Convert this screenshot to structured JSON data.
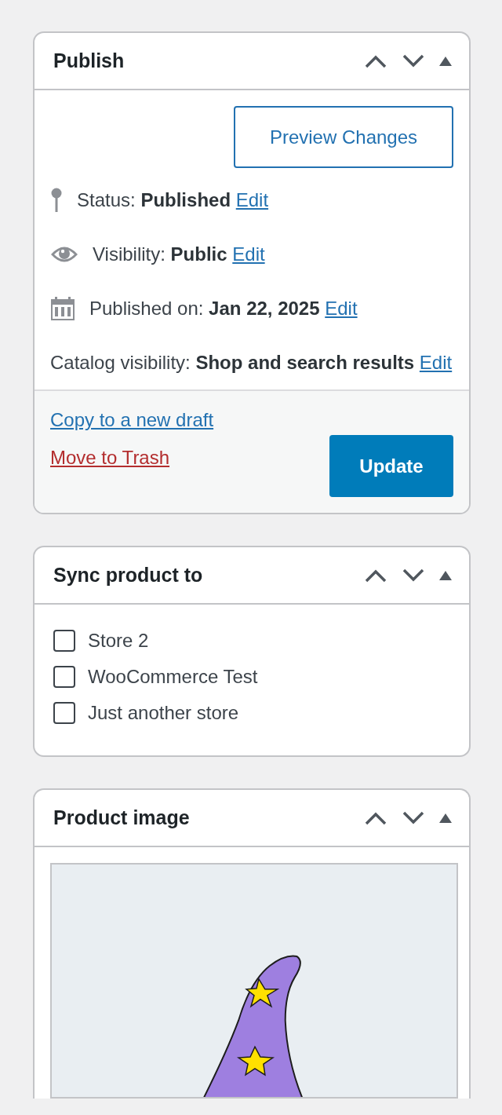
{
  "publish": {
    "title": "Publish",
    "preview_button": "Preview Changes",
    "rows": [
      {
        "kind": "pin",
        "label": "Status:",
        "value": "Published",
        "link": "Edit"
      },
      {
        "kind": "eye",
        "label": "Visibility:",
        "value": "Public",
        "link": "Edit"
      },
      {
        "kind": "calendar",
        "label": "Published on:",
        "value": "Jan 22, 2025",
        "link": "Edit"
      },
      {
        "kind": "plain",
        "label": "Catalog visibility:",
        "value": "Shop and search results",
        "link": "Edit"
      }
    ],
    "copy_link": "Copy to a new draft",
    "trash_link": "Move to Trash",
    "update_button": "Update"
  },
  "sync": {
    "title": "Sync product to",
    "stores": [
      {
        "label": "Store 2",
        "checked": false
      },
      {
        "label": "WooCommerce Test",
        "checked": false
      },
      {
        "label": "Just another store",
        "checked": false
      }
    ]
  },
  "product_image": {
    "title": "Product image"
  }
}
